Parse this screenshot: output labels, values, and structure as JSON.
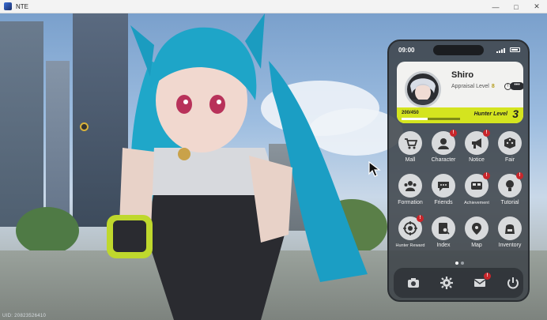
{
  "window": {
    "title": "NTE",
    "minimize": "—",
    "maximize": "□",
    "close": "✕"
  },
  "overlay": {
    "uid": "UID: 20823526410"
  },
  "phone": {
    "time": "09:00",
    "profile": {
      "name": "Shiro",
      "appraisal_label": "Appraisal Level",
      "appraisal_value": "8",
      "more_label": "•••",
      "exp_text": "200/450",
      "exp_fraction": 0.44,
      "hunter_label": "Hunter Level",
      "hunter_value": "3"
    },
    "apps": [
      {
        "label": "Mall",
        "icon": "cart-icon",
        "badge": false
      },
      {
        "label": "Character",
        "icon": "character-icon",
        "badge": true
      },
      {
        "label": "Notice",
        "icon": "megaphone-icon",
        "badge": true
      },
      {
        "label": "Fair",
        "icon": "dice-icon",
        "badge": false
      },
      {
        "label": "Formation",
        "icon": "formation-icon",
        "badge": false
      },
      {
        "label": "Friends",
        "icon": "friends-icon",
        "badge": false
      },
      {
        "label": "Achievement",
        "icon": "achievement-icon",
        "badge": true
      },
      {
        "label": "Tutorial",
        "icon": "lightbulb-icon",
        "badge": true
      },
      {
        "label": "Hunter Reward",
        "icon": "target-icon",
        "badge": true
      },
      {
        "label": "Index",
        "icon": "index-icon",
        "badge": false
      },
      {
        "label": "Map",
        "icon": "map-pin-icon",
        "badge": false
      },
      {
        "label": "Inventory",
        "icon": "backpack-icon",
        "badge": false
      }
    ],
    "badge_mark": "!",
    "dock": [
      {
        "icon": "camera-icon",
        "badge": false
      },
      {
        "icon": "gear-icon",
        "badge": false
      },
      {
        "icon": "mail-icon",
        "badge": true
      },
      {
        "icon": "power-icon",
        "badge": false
      }
    ]
  }
}
